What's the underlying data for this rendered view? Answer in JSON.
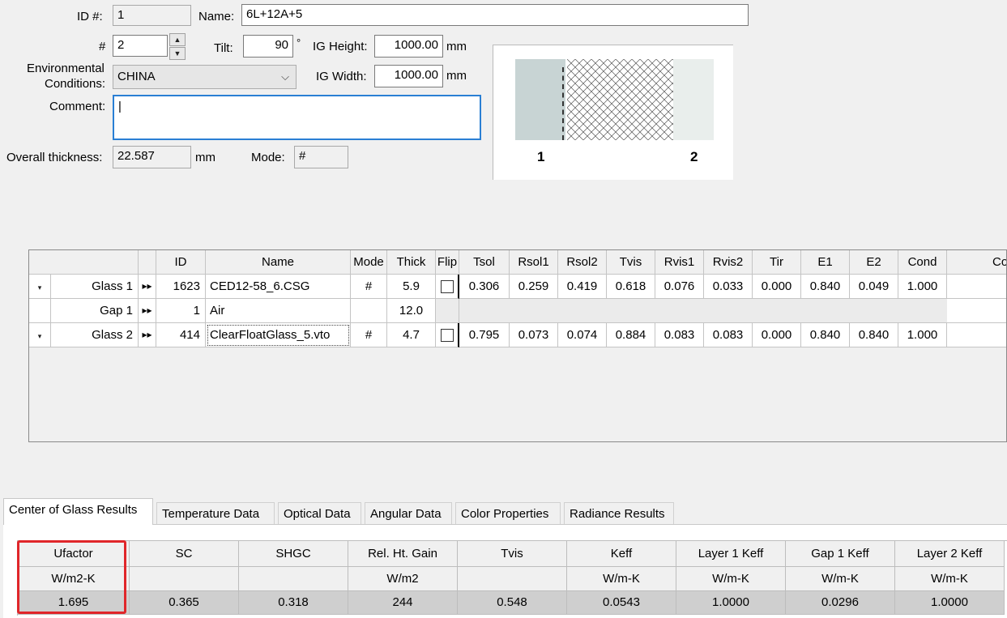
{
  "form": {
    "id_label": "ID #:",
    "id_value": "1",
    "name_label": "Name:",
    "name_value": "6L+12A+5",
    "num_label": "#",
    "num_value": "2",
    "tilt_label": "Tilt:",
    "tilt_value": "90",
    "tilt_unit": "°",
    "ig_height_label": "IG Height:",
    "ig_height_value": "1000.00",
    "ig_height_unit": "mm",
    "ig_width_label": "IG Width:",
    "ig_width_value": "1000.00",
    "ig_width_unit": "mm",
    "env_label_1": "Environmental",
    "env_label_2": "Conditions:",
    "env_value": "CHINA",
    "comment_label": "Comment:",
    "comment_value": "|",
    "thickness_label": "Overall thickness:",
    "thickness_value": "22.587",
    "thickness_unit": "mm",
    "mode_label": "Mode:",
    "mode_value": "#"
  },
  "preview": {
    "label_left": "1",
    "label_right": "2",
    "glass_color": "#c8d4d4"
  },
  "layers": {
    "headers": [
      "",
      "",
      "ID",
      "Name",
      "Mode",
      "Thick",
      "Flip",
      "Tsol",
      "Rsol1",
      "Rsol2",
      "Tvis",
      "Rvis1",
      "Rvis2",
      "Tir",
      "E1",
      "E2",
      "Cond",
      "Comm"
    ],
    "rows": [
      {
        "dd": "▾",
        "label": "Glass 1",
        "arrows": "▸▸",
        "id": "1623",
        "name": "CED12-58_6.CSG",
        "mode": "#",
        "thick": "5.9",
        "flip": true,
        "tsol": "0.306",
        "rsol1": "0.259",
        "rsol2": "0.419",
        "tvis": "0.618",
        "rvis1": "0.076",
        "rvis2": "0.033",
        "tir": "0.000",
        "e1": "0.840",
        "e2": "0.049",
        "cond": "1.000"
      },
      {
        "dd": "",
        "label": "Gap 1",
        "arrows": "▸▸",
        "id": "1",
        "name": "Air",
        "mode": "",
        "thick": "12.0",
        "flip": false,
        "tsol": "",
        "rsol1": "",
        "rsol2": "",
        "tvis": "",
        "rvis1": "",
        "rvis2": "",
        "tir": "",
        "e1": "",
        "e2": "",
        "cond": ""
      },
      {
        "dd": "▾",
        "label": "Glass 2",
        "arrows": "▸▸",
        "id": "414",
        "name": "ClearFloatGlass_5.vto",
        "mode": "#",
        "thick": "4.7",
        "flip": true,
        "tsol": "0.795",
        "rsol1": "0.073",
        "rsol2": "0.074",
        "tvis": "0.884",
        "rvis1": "0.083",
        "rvis2": "0.083",
        "tir": "0.000",
        "e1": "0.840",
        "e2": "0.840",
        "cond": "1.000"
      }
    ]
  },
  "tabs": [
    "Center of Glass Results",
    "Temperature Data",
    "Optical Data",
    "Angular Data",
    "Color Properties",
    "Radiance Results"
  ],
  "results": {
    "headers": [
      "Ufactor",
      "SC",
      "SHGC",
      "Rel. Ht. Gain",
      "Tvis",
      "Keff",
      "Layer 1 Keff",
      "Gap 1 Keff",
      "Layer 2 Keff"
    ],
    "units": [
      "W/m2-K",
      "",
      "",
      "W/m2",
      "",
      "W/m-K",
      "W/m-K",
      "W/m-K",
      "W/m-K"
    ],
    "values": [
      "1.695",
      "0.365",
      "0.318",
      "244",
      "0.548",
      "0.0543",
      "1.0000",
      "0.0296",
      "1.0000"
    ],
    "highlight_color": "#e0262a"
  }
}
